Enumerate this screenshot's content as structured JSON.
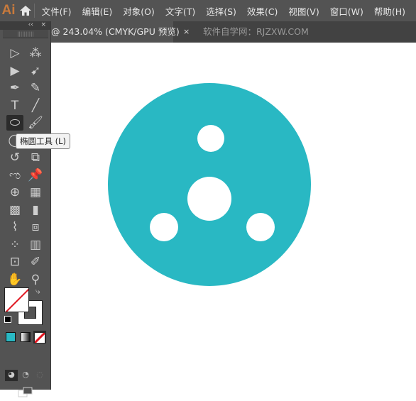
{
  "app": {
    "logo": "Ai"
  },
  "menu": [
    "文件(F)",
    "编辑(E)",
    "对象(O)",
    "文字(T)",
    "选择(S)",
    "效果(C)",
    "视图(V)",
    "窗口(W)",
    "帮助(H)"
  ],
  "tab": {
    "title": "@ 243.04% (CMYK/GPU 预览)",
    "close": "×",
    "site": "软件自学网：RJZXW.COM"
  },
  "panel": {
    "collapse": "‹‹",
    "close": "×"
  },
  "tooltip": "椭圆工具 (L)",
  "tools": [
    {
      "name": "selection-tool",
      "glyph": "▷"
    },
    {
      "name": "magic-wand-tool",
      "glyph": "⁂"
    },
    {
      "name": "direct-selection-tool",
      "glyph": "▶"
    },
    {
      "name": "lasso-tool",
      "glyph": "➹"
    },
    {
      "name": "pen-tool",
      "glyph": "✒"
    },
    {
      "name": "curvature-tool",
      "glyph": "✎"
    },
    {
      "name": "type-tool",
      "glyph": "T"
    },
    {
      "name": "line-tool",
      "glyph": "╱"
    },
    {
      "name": "ellipse-tool",
      "glyph": "⬭"
    },
    {
      "name": "paintbrush-tool",
      "glyph": "🖌"
    },
    {
      "name": "shaper-tool",
      "glyph": "◯"
    },
    {
      "name": "eraser-tool",
      "glyph": "◆"
    },
    {
      "name": "rotate-tool",
      "glyph": "↺"
    },
    {
      "name": "scale-tool",
      "glyph": "⧉"
    },
    {
      "name": "warp-tool",
      "glyph": "ಌ"
    },
    {
      "name": "puppet-warp-tool",
      "glyph": "📌"
    },
    {
      "name": "shape-builder-tool",
      "glyph": "⊕"
    },
    {
      "name": "perspective-grid-tool",
      "glyph": "▦"
    },
    {
      "name": "mesh-tool",
      "glyph": "▩"
    },
    {
      "name": "gradient-tool",
      "glyph": "▮"
    },
    {
      "name": "eyedropper-tool",
      "glyph": "⌇"
    },
    {
      "name": "blend-tool",
      "glyph": "⧈"
    },
    {
      "name": "symbol-sprayer-tool",
      "glyph": "⁘"
    },
    {
      "name": "column-graph-tool",
      "glyph": "▥"
    },
    {
      "name": "artboard-tool",
      "glyph": "⊡"
    },
    {
      "name": "slice-tool",
      "glyph": "✐"
    },
    {
      "name": "hand-tool",
      "glyph": "✋"
    },
    {
      "name": "zoom-tool",
      "glyph": "⚲"
    }
  ],
  "colors": {
    "shape": "#29b8c3",
    "fill_swatch": "#29b8c3",
    "none": "#e0141e"
  }
}
